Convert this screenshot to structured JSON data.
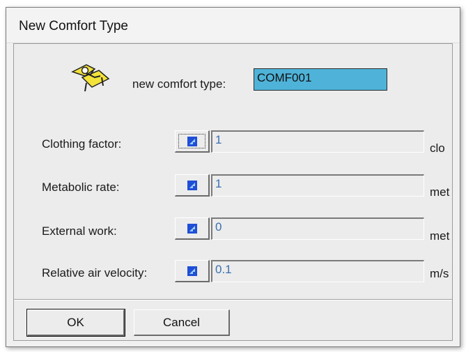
{
  "window": {
    "title": "New Comfort Type"
  },
  "header": {
    "label": "new comfort type:",
    "value": "COMF001",
    "icon": "reclining-person-icon"
  },
  "rows": [
    {
      "label": "Clothing factor:",
      "value": "1",
      "unit": "clo"
    },
    {
      "label": "Metabolic rate:",
      "value": "1",
      "unit": "met"
    },
    {
      "label": "External work:",
      "value": "0",
      "unit": "met"
    },
    {
      "label": "Relative air velocity:",
      "value": "0.1",
      "unit": "m/s"
    }
  ],
  "buttons": {
    "ok": "OK",
    "cancel": "Cancel"
  },
  "colors": {
    "type_field_bg": "#4fb3d9",
    "value_text": "#3a6fb0",
    "pick_icon": "#1f4fd6"
  }
}
